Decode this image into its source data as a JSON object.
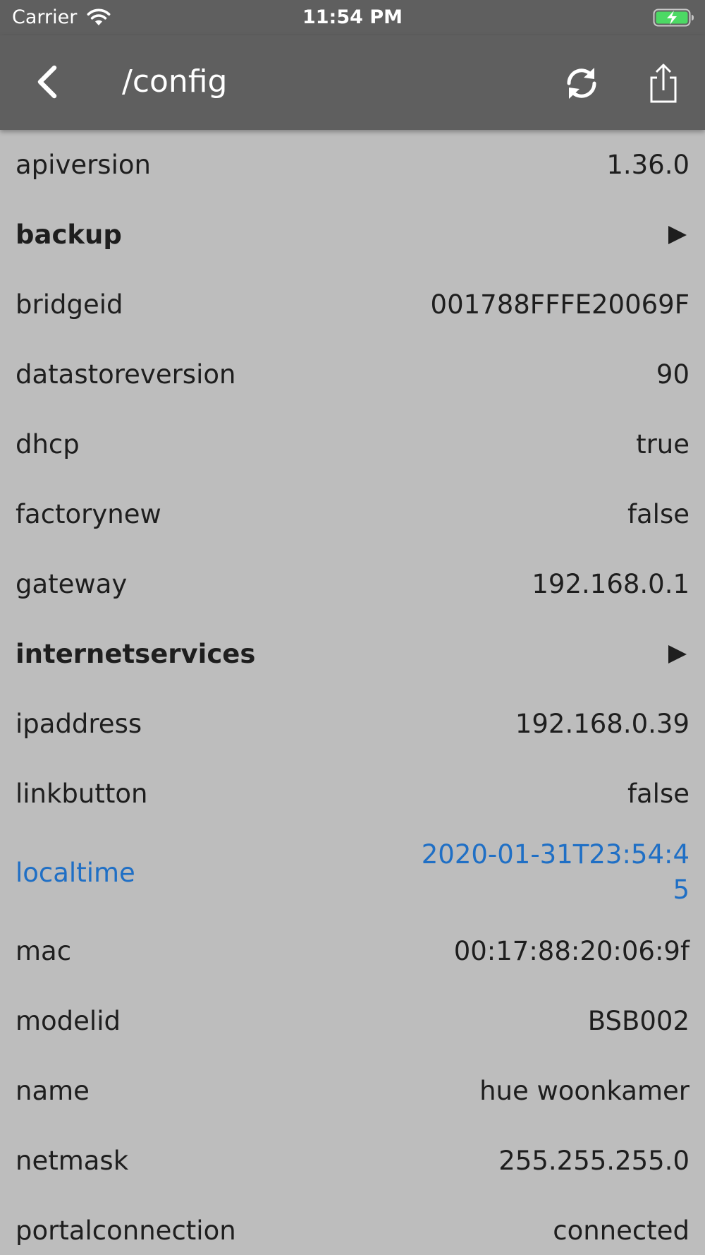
{
  "status_bar": {
    "carrier": "Carrier",
    "time": "11:54 PM"
  },
  "nav": {
    "title": "/config",
    "icons": {
      "back": "chevron-left-icon",
      "refresh": "refresh-icon",
      "share": "share-icon"
    }
  },
  "rows": [
    {
      "key": "apiversion",
      "value": "1.36.0"
    },
    {
      "key": "backup",
      "expandable": true
    },
    {
      "key": "bridgeid",
      "value": "001788FFFE20069F"
    },
    {
      "key": "datastoreversion",
      "value": "90"
    },
    {
      "key": "dhcp",
      "value": "true"
    },
    {
      "key": "factorynew",
      "value": "false"
    },
    {
      "key": "gateway",
      "value": "192.168.0.1"
    },
    {
      "key": "internetservices",
      "expandable": true
    },
    {
      "key": "ipaddress",
      "value": "192.168.0.39"
    },
    {
      "key": "linkbutton",
      "value": "false"
    },
    {
      "key": "localtime",
      "value": "2020-01-31T23:54:45",
      "highlighted": true
    },
    {
      "key": "mac",
      "value": "00:17:88:20:06:9f"
    },
    {
      "key": "modelid",
      "value": "BSB002"
    },
    {
      "key": "name",
      "value": "hue woonkamer"
    },
    {
      "key": "netmask",
      "value": "255.255.255.0"
    },
    {
      "key": "portalconnection",
      "value": "connected"
    }
  ],
  "colors": {
    "bar_background": "#5f5f5f",
    "list_background": "#bdbdbd",
    "text": "#1e1e1e",
    "link": "#1f6fc5",
    "battery_fill": "#4cd964"
  }
}
